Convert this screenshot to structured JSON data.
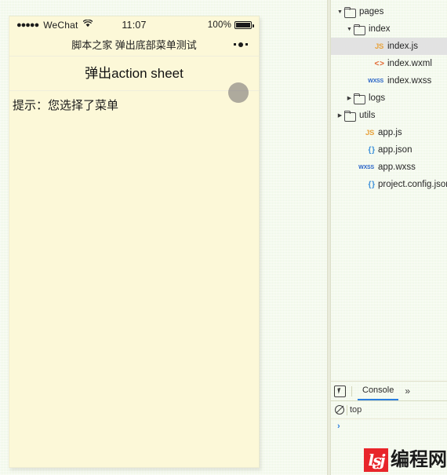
{
  "simulator": {
    "status_bar": {
      "signal_dots": "●●●●●",
      "carrier": "WeChat",
      "wifi_icon": "wifi-icon",
      "time": "11:07",
      "battery_percent": "100%",
      "battery_icon": "battery-icon"
    },
    "nav_bar": {
      "title": "脚本之家 弹出底部菜单测试",
      "more_icon": "more-dots-icon"
    },
    "page": {
      "action_button_label": "弹出action sheet",
      "tip_text": "提示：您选择了菜单",
      "touch_indicator": "touch-point-icon"
    }
  },
  "ide": {
    "file_tree": [
      {
        "label": "pages",
        "icon": "folder-open-icon",
        "twisty": "▼",
        "depth": 0,
        "selected": false,
        "type": "folder"
      },
      {
        "label": "index",
        "icon": "folder-open-icon",
        "twisty": "▼",
        "depth": 1,
        "selected": false,
        "type": "folder"
      },
      {
        "label": "index.js",
        "icon": "js-file-icon",
        "icon_text": "JS",
        "twisty": "",
        "depth": 2,
        "selected": true,
        "type": "file"
      },
      {
        "label": "index.wxml",
        "icon": "wxml-file-icon",
        "icon_text": "< >",
        "twisty": "",
        "depth": 2,
        "selected": false,
        "type": "file"
      },
      {
        "label": "index.wxss",
        "icon": "wxss-file-icon",
        "icon_text": "WXSS",
        "twisty": "",
        "depth": 2,
        "selected": false,
        "type": "file"
      },
      {
        "label": "logs",
        "icon": "folder-closed-icon",
        "twisty": "▶",
        "depth": 1,
        "selected": false,
        "type": "folder"
      },
      {
        "label": "utils",
        "icon": "folder-closed-icon",
        "twisty": "▶",
        "depth": 0,
        "selected": false,
        "type": "folder"
      },
      {
        "label": "app.js",
        "icon": "js-file-icon",
        "icon_text": "JS",
        "twisty": "",
        "depth": 1,
        "selected": false,
        "type": "file"
      },
      {
        "label": "app.json",
        "icon": "json-file-icon",
        "icon_text": "{ }",
        "twisty": "",
        "depth": 1,
        "selected": false,
        "type": "file"
      },
      {
        "label": "app.wxss",
        "icon": "wxss-file-icon",
        "icon_text": "WXSS",
        "twisty": "",
        "depth": 1,
        "selected": false,
        "type": "file"
      },
      {
        "label": "project.config.json",
        "icon": "json-file-icon",
        "icon_text": "{ }",
        "twisty": "",
        "depth": 1,
        "selected": false,
        "type": "file"
      }
    ],
    "devtools": {
      "inspect_icon": "inspect-element-icon",
      "active_tab": "Console",
      "overflow_icon": "»",
      "clear_icon": "clear-console-icon",
      "context": "top",
      "prompt_caret": "›"
    }
  },
  "watermark": {
    "mark": "lʂj",
    "text": "编程网"
  },
  "colors": {
    "page_bg": "#f7fbe4",
    "phone_bg": "#fcf8d8",
    "accent_blue": "#2a7fe0",
    "js_orange": "#e8a33d",
    "wxml_orange": "#e0622c",
    "wxss_blue": "#2a64c8",
    "json_blue": "#3b8fd8",
    "logo_red": "#e8252a",
    "selected_row": "#e2e2e2"
  }
}
